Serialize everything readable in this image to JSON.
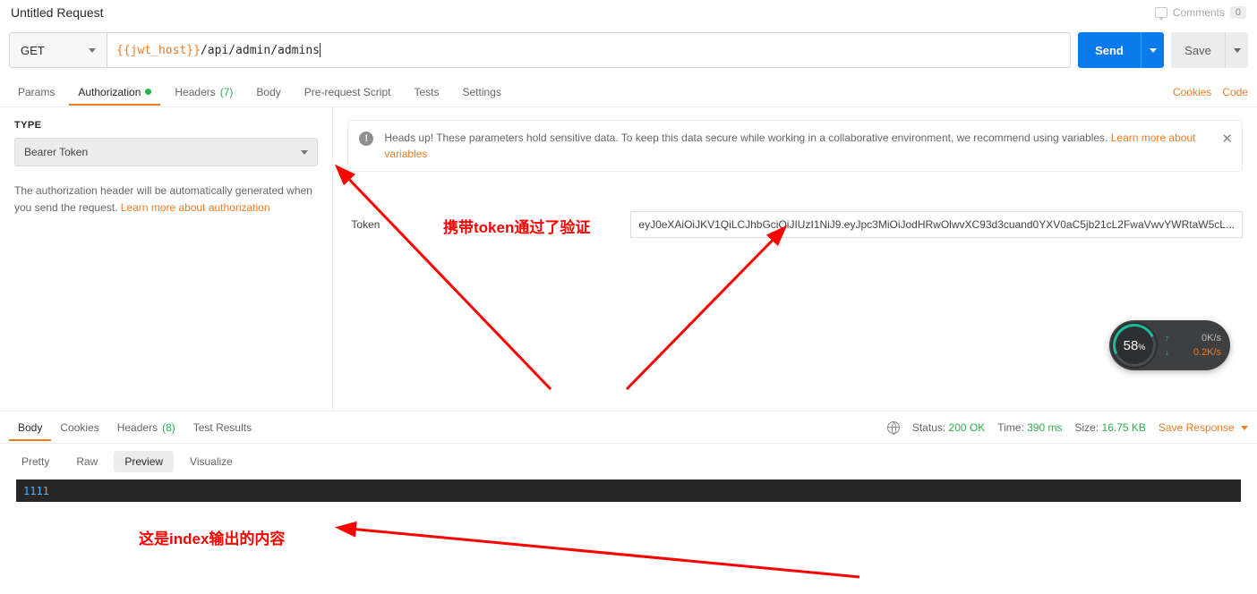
{
  "header": {
    "title": "Untitled Request",
    "comments_label": "Comments",
    "comments_count": "0"
  },
  "request": {
    "method": "GET",
    "url_var": "{{jwt_host}}",
    "url_path": "/api/admin/admins",
    "send_label": "Send",
    "save_label": "Save"
  },
  "req_tabs": {
    "params": "Params",
    "authorization": "Authorization",
    "headers": "Headers",
    "headers_count": "(7)",
    "body": "Body",
    "prerequest": "Pre-request Script",
    "tests": "Tests",
    "settings": "Settings",
    "cookies": "Cookies",
    "code": "Code"
  },
  "auth": {
    "type_label": "TYPE",
    "type_value": "Bearer Token",
    "desc_1": "The authorization header will be automatically generated when you send the request. ",
    "desc_link": "Learn more about authorization",
    "banner_text": "Heads up! These parameters hold sensitive data. To keep this data secure while working in a collaborative environment, we recommend using variables. ",
    "banner_link": "Learn more about variables",
    "token_label": "Token",
    "token_value": "eyJ0eXAiOiJKV1QiLCJhbGciOiJIUzI1NiJ9.eyJpc3MiOiJodHRwOlwvXC93d3cuand0YXV0aC5jb21cL2FwaVwvYWRtaW5cL..."
  },
  "response": {
    "tabs": {
      "body": "Body",
      "cookies": "Cookies",
      "headers": "Headers",
      "headers_count": "(8)",
      "test_results": "Test Results"
    },
    "meta": {
      "status_label": "Status:",
      "status_val": "200 OK",
      "time_label": "Time:",
      "time_val": "390 ms",
      "size_label": "Size:",
      "size_val": "16.75 KB",
      "save_response": "Save Response"
    },
    "subtabs": {
      "pretty": "Pretty",
      "raw": "Raw",
      "preview": "Preview",
      "visualize": "Visualize"
    },
    "preview_content": "1111"
  },
  "annotations": {
    "text1": "携带token通过了验证",
    "text2": "这是index输出的内容"
  },
  "speed": {
    "percent": "58",
    "unit": "%",
    "up": "0K/s",
    "down": "0.2K/s"
  }
}
